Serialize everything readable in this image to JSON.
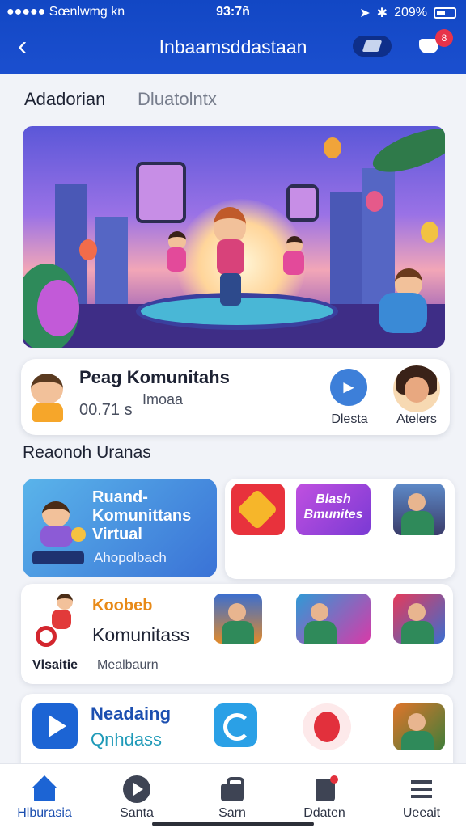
{
  "status_bar": {
    "carrier": "●●●●● Sœnlwmg kn",
    "time": "93:7ñ",
    "battery": "209%"
  },
  "header": {
    "back_icon": "chevron-left-icon",
    "title": "Inbaamsddastaan",
    "notification_count": "8"
  },
  "subtabs": [
    "Adadorian",
    "Dluatolntx"
  ],
  "community_card": {
    "title": "Peag Komunitahs",
    "stat": "00.71 s",
    "stat_secondary": "Imoaa",
    "play_label": "Dlesta",
    "avatar_label": "Atelers"
  },
  "section_title": "Reaonoh Uranas",
  "virtual_card": {
    "title": "Ruand-Komunittans Virtual",
    "subtitle": "Ahopolbach"
  },
  "virtual_row_tiles": [
    {
      "label": "Blash Bmunites"
    }
  ],
  "komunitas_card": {
    "label_top": "Koobeb",
    "label_main": "Komunitass",
    "footer_bold": "Vlsaitie",
    "footer_text": "Mealbaurn"
  },
  "reading_card": {
    "line1": "Neadaing",
    "line2": "Qnhdass"
  },
  "bottom_nav": [
    {
      "label": "Hlburasia",
      "icon": "home-icon",
      "active": true
    },
    {
      "label": "Santa",
      "icon": "play-icon",
      "active": false
    },
    {
      "label": "Sarn",
      "icon": "bag-icon",
      "active": false
    },
    {
      "label": "Ddaten",
      "icon": "document-icon",
      "active": false
    },
    {
      "label": "Ueeait",
      "icon": "menu-icon",
      "active": false
    }
  ],
  "colors": {
    "header": "#1b4fcf",
    "accent": "#1c64d4",
    "badge": "#e7334a",
    "background": "#f1f3f8"
  }
}
